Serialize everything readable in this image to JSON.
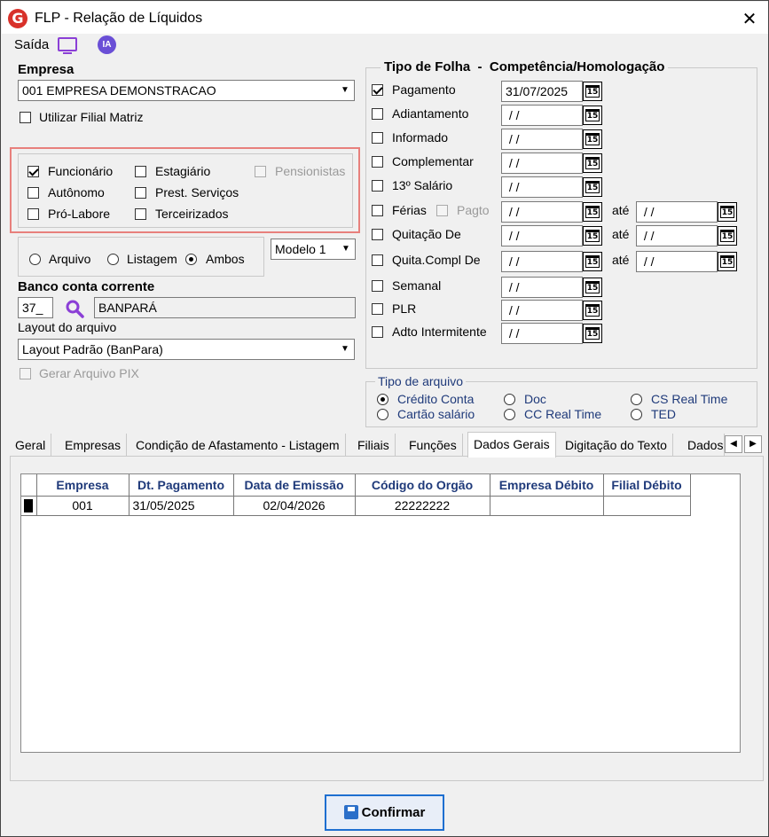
{
  "window": {
    "title": "FLP - Relação de Líquidos",
    "close": "✕",
    "logo": "G"
  },
  "toolbar": {
    "saida": "Saída",
    "ia": "IA"
  },
  "empresa": {
    "label": "Empresa",
    "value": "001 EMPRESA DEMONSTRACAO",
    "filial_label": "Utilizar Filial Matriz"
  },
  "tipos": {
    "funcionario": "Funcionário",
    "estagiario": "Estagiário",
    "pensionistas": "Pensionistas",
    "autonomo": "Autônomo",
    "prest": "Prest. Serviços",
    "pro_labore": "Pró-Labore",
    "terceirizados": "Terceirizados"
  },
  "saida_tipo": {
    "arquivo": "Arquivo",
    "listagem": "Listagem",
    "ambos": "Ambos",
    "modelo": "Modelo 1"
  },
  "banco": {
    "label": "Banco conta corrente",
    "code": "37_",
    "name": "BANPARÁ"
  },
  "layout": {
    "label": "Layout do arquivo",
    "value": "Layout Padrão (BanPara)",
    "pix": "Gerar Arquivo PIX"
  },
  "folha": {
    "header": "Tipo de Folha  -  Competência/Homologação",
    "ate": "até",
    "items": [
      {
        "label": "Pagamento",
        "date": "31/07/2025"
      },
      {
        "label": "Adiantamento",
        "date": " / /"
      },
      {
        "label": "Informado",
        "date": " / /"
      },
      {
        "label": "Complementar",
        "date": " / /"
      },
      {
        "label": "13º Salário",
        "date": " / /"
      },
      {
        "label": "Férias",
        "date": " / /",
        "extra": "Pagto",
        "date2": " / /"
      },
      {
        "label": "Quitação De",
        "date": " / /",
        "date2": " / /"
      },
      {
        "label": "Quita.Compl De",
        "date": " / /",
        "date2": " / /"
      },
      {
        "label": "Semanal",
        "date": " / /"
      },
      {
        "label": "PLR",
        "date": " / /"
      },
      {
        "label": "Adto Intermitente",
        "date": " / /"
      }
    ],
    "cal": "15"
  },
  "tipo_arquivo": {
    "label": "Tipo de arquivo",
    "credito": "Crédito Conta",
    "doc": "Doc",
    "cs": "CS Real Time",
    "cartao": "Cartão salário",
    "cc": "CC Real Time",
    "ted": "TED"
  },
  "tabs": [
    "Geral",
    "Empresas",
    "Condição de Afastamento - Listagem",
    "Filiais",
    "Funções",
    "Dados Gerais",
    "Digitação do Texto",
    "Dados"
  ],
  "grid": {
    "columns": [
      "Empresa",
      "Dt. Pagamento",
      "Data de Emissão",
      "Código do Orgão",
      "Empresa Débito",
      "Filial Débito"
    ],
    "rows": [
      [
        "001",
        "31/05/2025",
        "02/04/2026",
        "22222222",
        "",
        ""
      ]
    ]
  },
  "confirm": "Confirmar",
  "colors": {
    "accent": "#1f3a7a",
    "highlight_border": "#e8807c",
    "purple": "#8b3fd6"
  }
}
